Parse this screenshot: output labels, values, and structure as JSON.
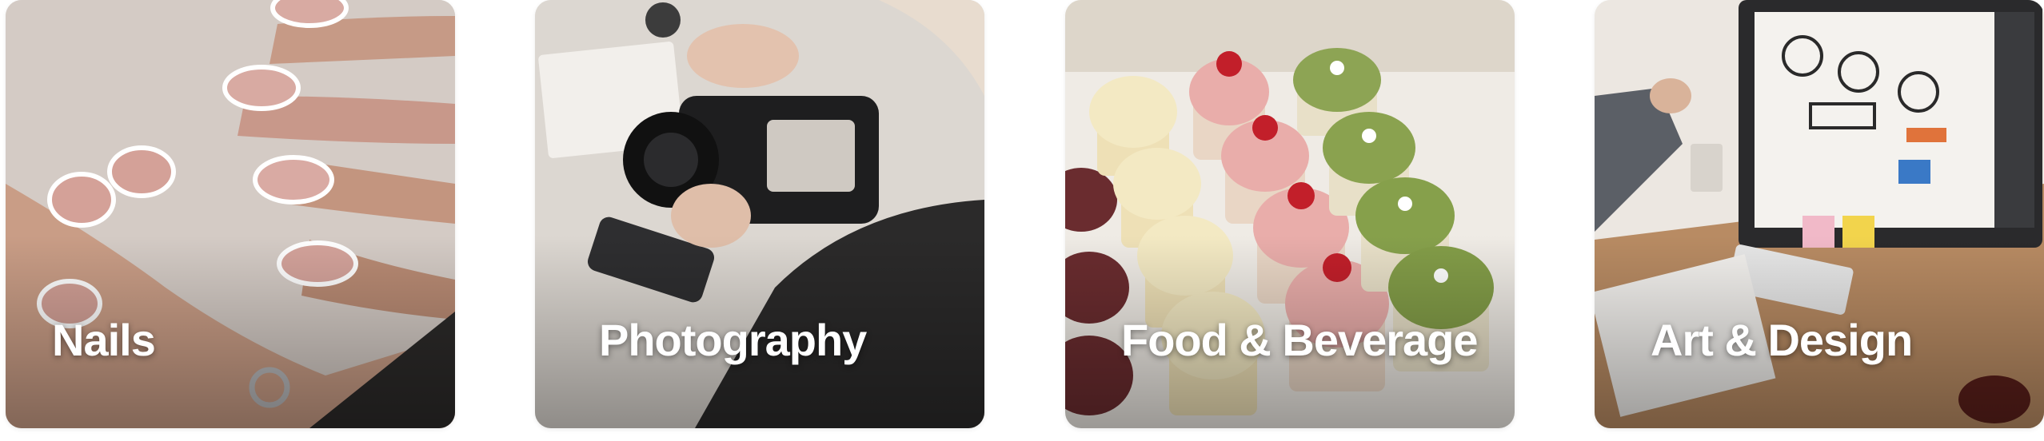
{
  "categories": [
    {
      "label": "Nails"
    },
    {
      "label": "Photography"
    },
    {
      "label": "Food & Beverage"
    },
    {
      "label": "Art & Design"
    }
  ]
}
